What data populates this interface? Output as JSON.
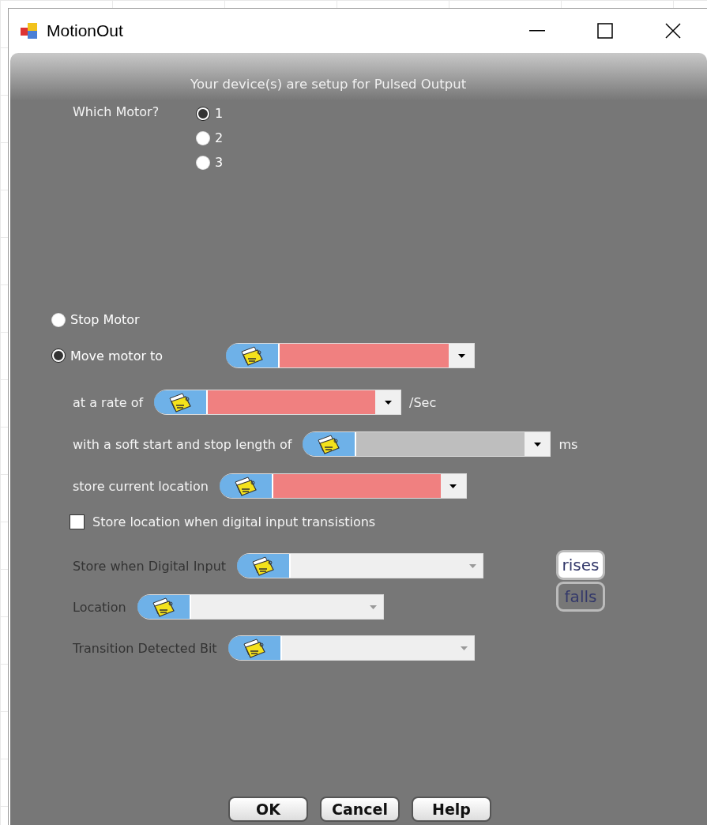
{
  "window": {
    "title": "MotionOut"
  },
  "header": "Your device(s) are setup for Pulsed Output",
  "motor_select": {
    "label": "Which Motor?",
    "options": [
      {
        "label": "1",
        "selected": true
      },
      {
        "label": "2",
        "selected": false
      },
      {
        "label": "3",
        "selected": false
      }
    ]
  },
  "action": [
    {
      "label": "Stop Motor",
      "selected": false
    },
    {
      "label": "Move motor to",
      "selected": true
    }
  ],
  "move_target": {
    "color": "#f08080"
  },
  "settings": [
    {
      "label": "at a rate of",
      "color": "#f08080",
      "unit": "/Sec"
    },
    {
      "label": "with a soft start and stop length of",
      "color": "#bebebe",
      "unit": "ms"
    },
    {
      "label": "store current location",
      "color": "#f08080"
    }
  ],
  "store_on_transition": {
    "label": "Store location when digital input transistions",
    "checked": false
  },
  "transition_fields": [
    {
      "label": "Store when Digital Input",
      "disabled": true
    },
    {
      "label": "Location",
      "disabled": true
    },
    {
      "label": "Transition Detected Bit",
      "disabled": true
    }
  ],
  "edge": [
    {
      "label": "rises",
      "selected": true
    },
    {
      "label": "falls",
      "selected": false
    }
  ],
  "buttons": [
    "OK",
    "Cancel",
    "Help"
  ]
}
